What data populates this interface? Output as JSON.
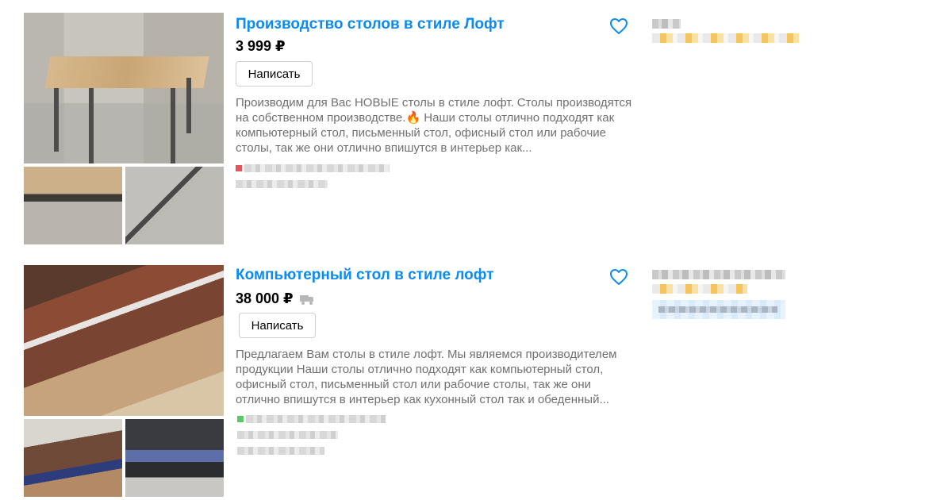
{
  "listings": [
    {
      "title": "Производство столов в стиле Лофт",
      "price": "3 999 ₽",
      "write_button": "Написать",
      "description": "Производим для Вас НОВЫЕ столы в стиле лофт. Столы производятся на собственном производстве.🔥 Наши столы отлично подходят как компьютерный стол, письменный стол, офисный стол или рабочие столы, так же они отлично впишутся в интерьер как...",
      "delivery_icon": false,
      "status_dot_color": "#e8525a",
      "favorite_icon": "heart-outline-icon"
    },
    {
      "title": "Компьютерный стол в стиле лофт",
      "price": "38 000 ₽",
      "write_button": "Написать",
      "description": "Предлагаем Вам столы в стиле лофт. Мы являемся производителем продукции Наши столы отлично подходят как компьютерный стол, офисный стол, письменный стол или рабочие столы, так же они отлично впишутся в интерьер как кухонный стол так и обеденный...",
      "delivery_icon": true,
      "status_dot_color": "#5fc46a",
      "favorite_icon": "heart-outline-icon"
    }
  ],
  "colors": {
    "title_link": "#0a8af5",
    "description_text": "#707070",
    "heart": "#0a8af5"
  }
}
